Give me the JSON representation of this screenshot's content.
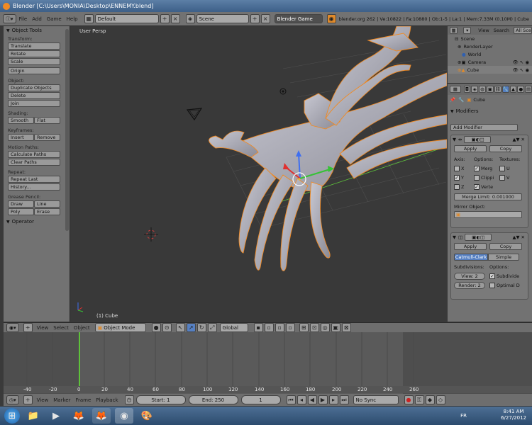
{
  "window": {
    "title": "Blender [C:\\Users\\MONIA\\Desktop\\ENNEMY.blend]"
  },
  "infobar": {
    "menus": [
      "File",
      "Add",
      "Game",
      "Help"
    ],
    "layout": "Default",
    "scene": "Scene",
    "engine": "Blender Game",
    "stats": "blender.org 262 | Ve:10822 | Fa:10880 | Ob:1-5 | La:1 | Mem:7.33M (0.10M) | Cube"
  },
  "toolshelf": {
    "header": "Object Tools",
    "transform_label": "Transform:",
    "translate": "Translate",
    "rotate": "Rotate",
    "scale": "Scale",
    "origin": "Origin",
    "object_label": "Object:",
    "duplicate": "Duplicate Objects",
    "delete": "Delete",
    "join": "Join",
    "shading_label": "Shading:",
    "smooth": "Smooth",
    "flat": "Flat",
    "keyframes_label": "Keyframes:",
    "insert": "Insert",
    "remove": "Remove",
    "motion_label": "Motion Paths:",
    "calc_paths": "Calculate Paths",
    "clear_paths": "Clear Paths",
    "repeat_label": "Repeat:",
    "repeat_last": "Repeat Last",
    "history": "History...",
    "grease_label": "Grease Pencil:",
    "draw": "Draw",
    "line": "Line",
    "poly": "Poly",
    "erase": "Erase",
    "operator_header": "Operator"
  },
  "viewport": {
    "title": "User Persp",
    "object": "(1) Cube"
  },
  "outliner": {
    "view": "View",
    "search": "Search",
    "allscenes": "All Scen",
    "items": [
      "Scene",
      "RenderLayer",
      "World",
      "Camera",
      "Cube"
    ]
  },
  "properties": {
    "context": "Cube",
    "modifiers_header": "Modifiers",
    "add_modifier": "Add Modifier",
    "mirror": {
      "apply": "Apply",
      "copy": "Copy",
      "axis_label": "Axis:",
      "options_label": "Options:",
      "textures_label": "Textures:",
      "x": "X",
      "y": "Y",
      "z": "Z",
      "merge": "Merg",
      "clipping": "Clippi",
      "vertex": "Verte",
      "u": "U",
      "v": "V",
      "merge_limit": "Merge Limit: 0.001000",
      "mirror_object": "Mirror Object:"
    },
    "subsurf": {
      "apply": "Apply",
      "copy": "Copy",
      "catmull": "Catmull-Clark",
      "simple": "Simple",
      "subdivisions_label": "Subdivisions:",
      "options_label": "Options:",
      "view": "View: 2",
      "render": "Render: 2",
      "subdivide": "Subdivide",
      "optimal": "Optimal D"
    }
  },
  "view3d_header": {
    "menus": [
      "View",
      "Select",
      "Object"
    ],
    "mode": "Object Mode",
    "orientation": "Global"
  },
  "timeline": {
    "ticks": [
      "-40",
      "-20",
      "0",
      "20",
      "40",
      "60",
      "80",
      "100",
      "120",
      "140",
      "160",
      "180",
      "200",
      "220",
      "240",
      "260"
    ],
    "menus": [
      "View",
      "Marker",
      "Frame",
      "Playback"
    ],
    "start": "Start: 1",
    "end": "End: 250",
    "current": "1",
    "sync": "No Sync"
  },
  "taskbar": {
    "lang": "FR",
    "time": "8:41 AM",
    "date": "6/27/2012"
  },
  "colors": {
    "accent_orange": "#f08a24",
    "selection_blue": "#5680c2",
    "timeline_green": "#5ec23a"
  }
}
